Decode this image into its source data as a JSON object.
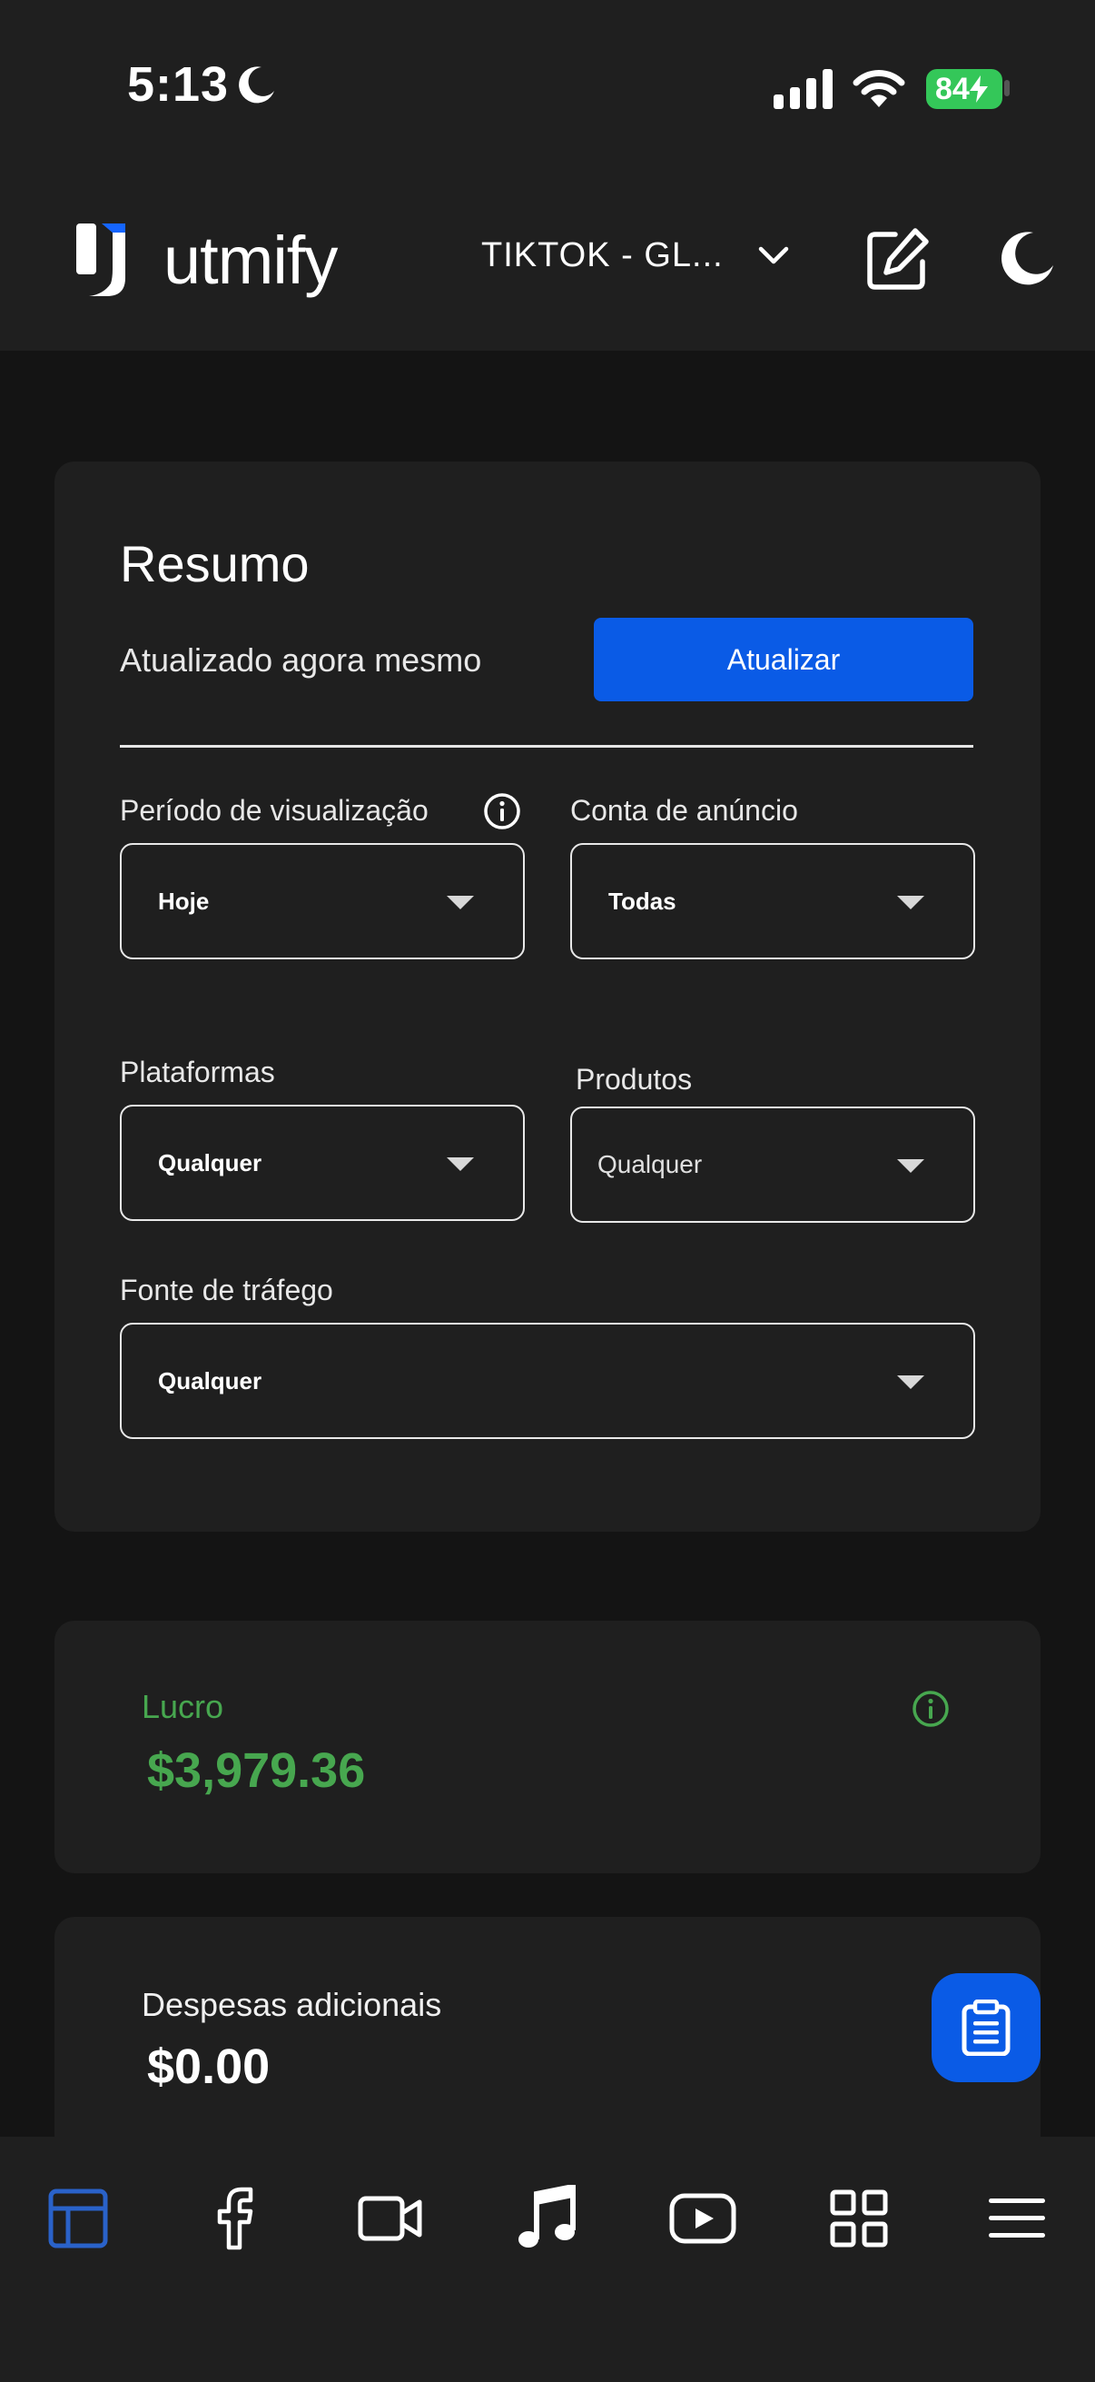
{
  "status_bar": {
    "time": "5:13",
    "battery": "84"
  },
  "header": {
    "logo_text": "utmify",
    "account_label": "TIKTOK - GL...",
    "icons": [
      "chevron-down-icon",
      "edit-icon",
      "moon-icon"
    ]
  },
  "summary": {
    "title": "Resumo",
    "updated_text": "Atualizado agora mesmo",
    "update_button": "Atualizar",
    "filters": {
      "period": {
        "label": "Período de visualização",
        "value": "Hoje"
      },
      "ad_account": {
        "label": "Conta de anúncio",
        "value": "Todas"
      },
      "platforms": {
        "label": "Plataformas",
        "value": "Qualquer"
      },
      "products": {
        "label": "Produtos",
        "value": "Qualquer"
      },
      "traffic_source": {
        "label": "Fonte de tráfego",
        "value": "Qualquer"
      }
    }
  },
  "profit": {
    "label": "Lucro",
    "value": "$3,979.36",
    "color": "#47a74f"
  },
  "additional_expenses": {
    "label": "Despesas adicionais",
    "value": "$0.00"
  },
  "colors": {
    "accent": "#0a5be6",
    "background": "#141414",
    "card": "#1f1f1f",
    "profit": "#47a74f"
  },
  "bottom_nav": [
    "dashboard-icon",
    "facebook-icon",
    "video-icon",
    "music-icon",
    "youtube-icon",
    "grid-icon",
    "menu-icon"
  ]
}
